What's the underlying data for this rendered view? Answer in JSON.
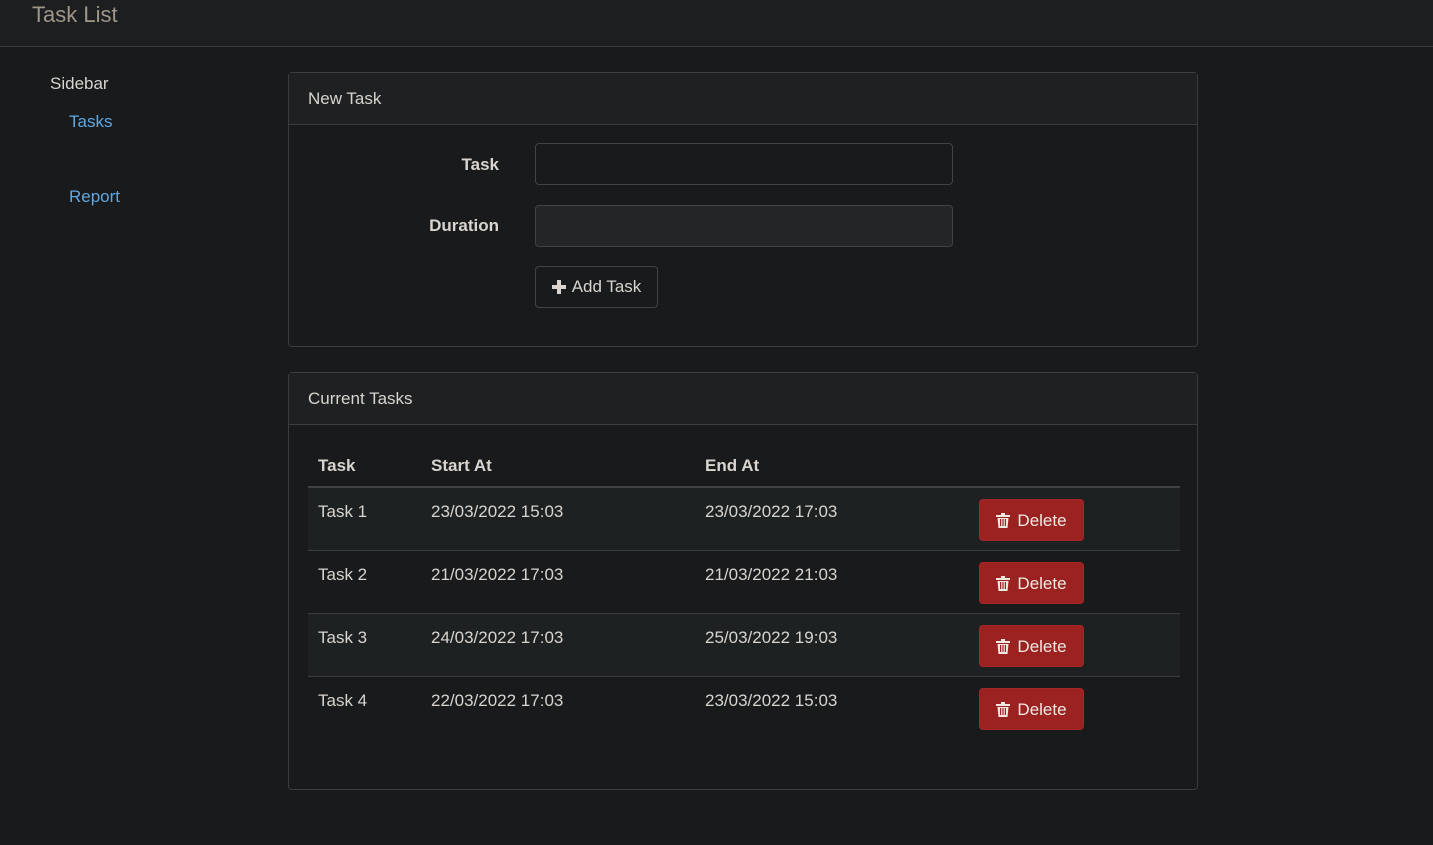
{
  "app": {
    "title": "Task List"
  },
  "sidebar": {
    "title": "Sidebar",
    "items": [
      {
        "label": "Tasks"
      },
      {
        "label": "Report"
      }
    ]
  },
  "new_task": {
    "heading": "New Task",
    "task_label": "Task",
    "task_value": "",
    "duration_label": "Duration",
    "duration_value": "",
    "add_button_label": "Add Task",
    "add_button_icon": "plus-icon"
  },
  "current_tasks": {
    "heading": "Current Tasks",
    "columns": [
      "Task",
      "Start At",
      "End At"
    ],
    "rows": [
      {
        "task": "Task 1",
        "start": "23/03/2022 15:03",
        "end": "23/03/2022 17:03",
        "action": "Delete"
      },
      {
        "task": "Task 2",
        "start": "21/03/2022 17:03",
        "end": "21/03/2022 21:03",
        "action": "Delete"
      },
      {
        "task": "Task 3",
        "start": "24/03/2022 17:03",
        "end": "25/03/2022 19:03",
        "action": "Delete"
      },
      {
        "task": "Task 4",
        "start": "22/03/2022 17:03",
        "end": "23/03/2022 15:03",
        "action": "Delete"
      }
    ],
    "delete_icon": "trash-icon"
  },
  "colors": {
    "background": "#181a1b",
    "link": "#5fa8e3",
    "danger": "#9b2221"
  }
}
